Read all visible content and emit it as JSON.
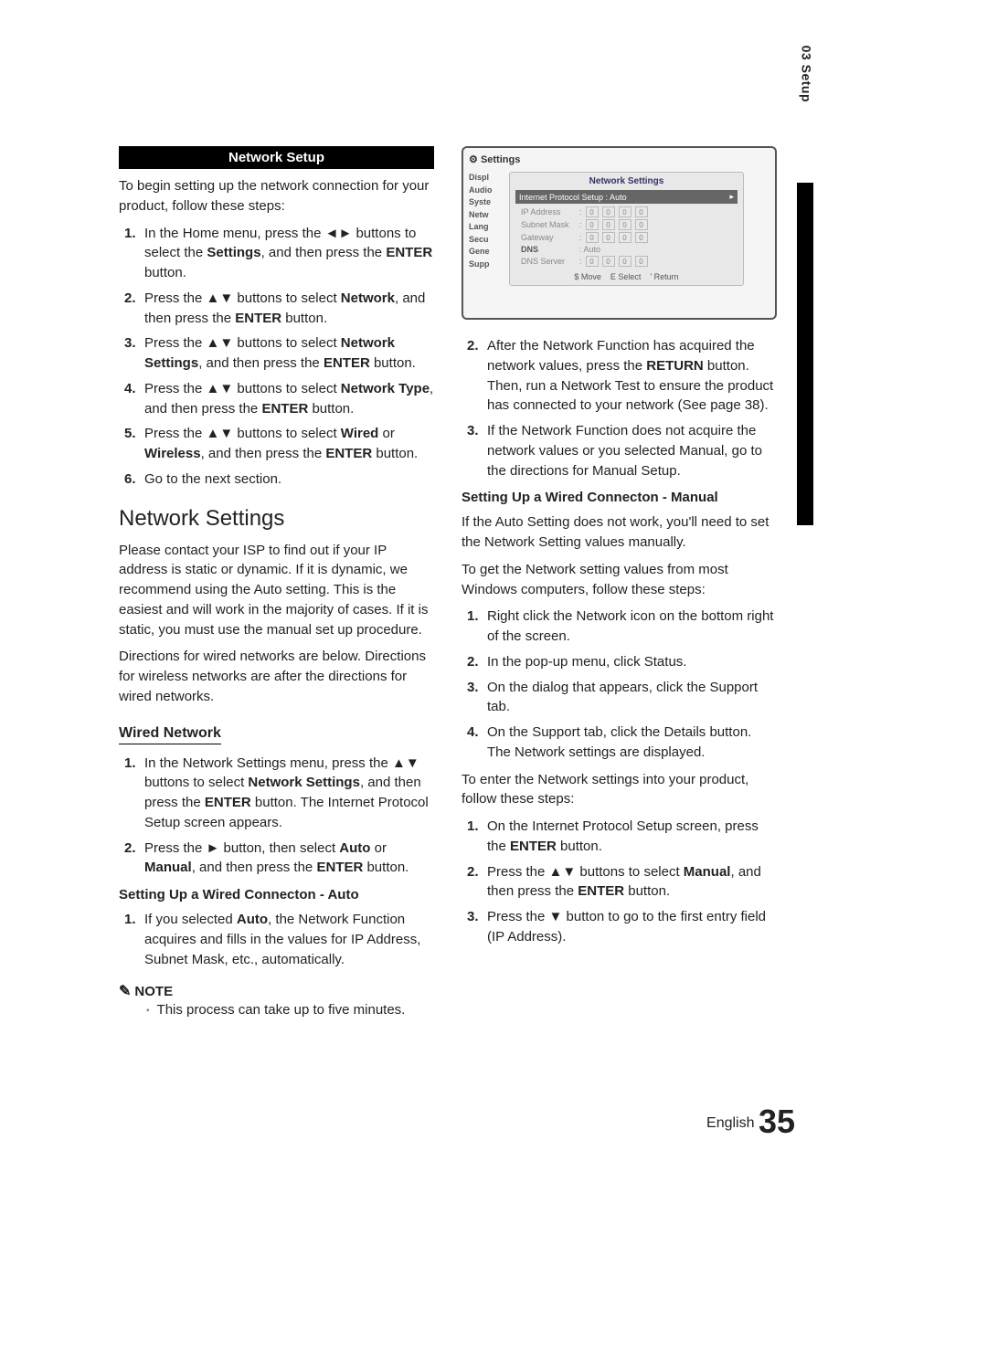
{
  "side_tab": "03   Setup",
  "left": {
    "header": "Network Setup",
    "intro": "To begin setting up the network connection for your product, follow these steps:",
    "steps": [
      {
        "n": "1.",
        "txt": "In the Home menu, press the ◄► buttons to select the <b>Settings</b>, and then press the <b>ENTER</b> button."
      },
      {
        "n": "2.",
        "txt": "Press the ▲▼ buttons to select <b>Network</b>, and then press the <b>ENTER</b> button."
      },
      {
        "n": "3.",
        "txt": "Press the ▲▼ buttons to select <b>Network Settings</b>, and then press the <b>ENTER</b> button."
      },
      {
        "n": "4.",
        "txt": "Press the ▲▼ buttons to select <b>Network Type</b>, and then press the <b>ENTER</b> button."
      },
      {
        "n": "5.",
        "txt": "Press the ▲▼ buttons to select <b>Wired</b> or <b>Wireless</b>, and then press the <b>ENTER</b> button."
      },
      {
        "n": "6.",
        "txt": "Go to the next section."
      }
    ],
    "h2": "Network Settings",
    "para1": "Please contact your ISP to find out if your IP address is static or dynamic. If it is dynamic, we recommend using the Auto setting. This is the easiest and will work in the majority of cases. If it is static, you must use the manual set up procedure.",
    "para2": "Directions for wired networks are below. Directions for wireless networks are after the directions for wired networks.",
    "wired_heading": "Wired Network",
    "wired_steps": [
      {
        "n": "1.",
        "txt": "In the Network Settings menu, press the ▲▼ buttons to select <b>Network Settings</b>, and then press the <b>ENTER</b> button. The Internet Protocol Setup screen appears."
      },
      {
        "n": "2.",
        "txt": "Press the ► button, then select <b>Auto</b> or <b>Manual</b>, and then press the <b>ENTER</b> button."
      }
    ],
    "auto_heading": "Setting Up a Wired Connecton - Auto",
    "auto_steps": [
      {
        "n": "1.",
        "txt": "If you selected <b>Auto</b>, the Network Function acquires and fills in the values for IP Address, Subnet Mask, etc., automatically."
      }
    ],
    "note_label": "NOTE",
    "note_text": "This process can take up to five minutes."
  },
  "screenshot": {
    "settings_label": "Settings",
    "panel_title": "Network Settings",
    "ips_label": "Internet Protocol Setup  : Auto",
    "side_items": [
      "Displ",
      "Audio",
      "Syste",
      "Netw",
      "Lang",
      "Secu",
      "Gene",
      "Supp"
    ],
    "rows": [
      {
        "label": "IP Address",
        "vals": [
          "0",
          "0",
          "0",
          "0"
        ]
      },
      {
        "label": "Subnet Mask",
        "vals": [
          "0",
          "0",
          "0",
          "0"
        ]
      },
      {
        "label": "Gateway",
        "vals": [
          "0",
          "0",
          "0",
          "0"
        ]
      }
    ],
    "dns_label": "DNS",
    "dns_val": ": Auto",
    "dns_server": {
      "label": "DNS Server",
      "vals": [
        "0",
        "0",
        "0",
        "0"
      ]
    },
    "footer_move": "$ Move",
    "footer_select": "E Select",
    "footer_return": "' Return"
  },
  "right": {
    "cont_steps": [
      {
        "n": "2.",
        "txt": "After the Network Function has acquired the network values, press the <b>RETURN</b> button. Then, run a Network Test to ensure the product has connected to your network (See page 38)."
      },
      {
        "n": "3.",
        "txt": "If the Network Function does not acquire the network values or you selected Manual, go to the directions for Manual Setup."
      }
    ],
    "manual_heading": "Setting Up a Wired Connecton - Manual",
    "manual_intro1": "If the Auto Setting does not work, you'll need to set the Network Setting values manually.",
    "manual_intro2": "To get the Network setting values from most Windows computers, follow these steps:",
    "manual_steps_a": [
      {
        "n": "1.",
        "txt": "Right click the Network icon on the bottom right of the screen."
      },
      {
        "n": "2.",
        "txt": "In the pop-up menu, click Status."
      },
      {
        "n": "3.",
        "txt": "On the dialog that appears, click the Support tab."
      },
      {
        "n": "4.",
        "txt": "On the Support tab, click the Details button. The Network settings are displayed."
      }
    ],
    "manual_intro3": "To enter the Network settings into your product, follow these steps:",
    "manual_steps_b": [
      {
        "n": "1.",
        "txt": "On the Internet Protocol Setup screen, press the <b>ENTER</b> button."
      },
      {
        "n": "2.",
        "txt": "Press the ▲▼ buttons to select <b>Manual</b>, and then press the <b>ENTER</b> button."
      },
      {
        "n": "3.",
        "txt": "Press the ▼ button to go to the first entry field (IP Address)."
      }
    ]
  },
  "footer": {
    "lang": "English",
    "page": "35"
  }
}
